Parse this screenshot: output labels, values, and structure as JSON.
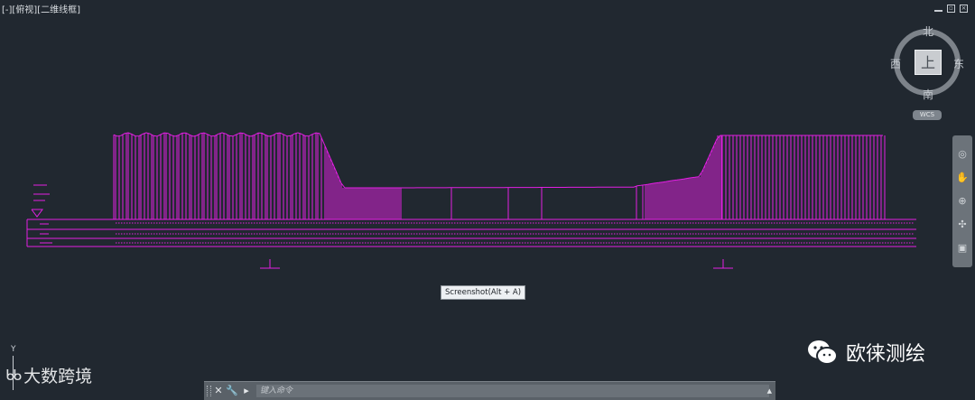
{
  "viewport": {
    "label": "[-][俯视][二维线框]"
  },
  "viewcube": {
    "face": "上",
    "north": "北",
    "south": "南",
    "east": "东",
    "west": "西",
    "wcs": "WCS"
  },
  "tooltip": {
    "text": "Screenshot(Alt + A)"
  },
  "ucs": {
    "axis_y": "Y"
  },
  "command_line": {
    "placeholder": "键入命令"
  },
  "watermarks": {
    "left_logo": "ᑲᑲ",
    "left_text": "大数跨境",
    "right_text": "欧徕测绘"
  },
  "colors": {
    "background": "#212830",
    "profile": "#e21fe2",
    "navbar": "#6c737a"
  },
  "icons": [
    "close-icon",
    "wrench-icon",
    "command-prompt-icon",
    "wheel-icon",
    "pan-icon",
    "zoom-icon",
    "orbit-icon",
    "showmotion-icon",
    "wechat-icon"
  ]
}
